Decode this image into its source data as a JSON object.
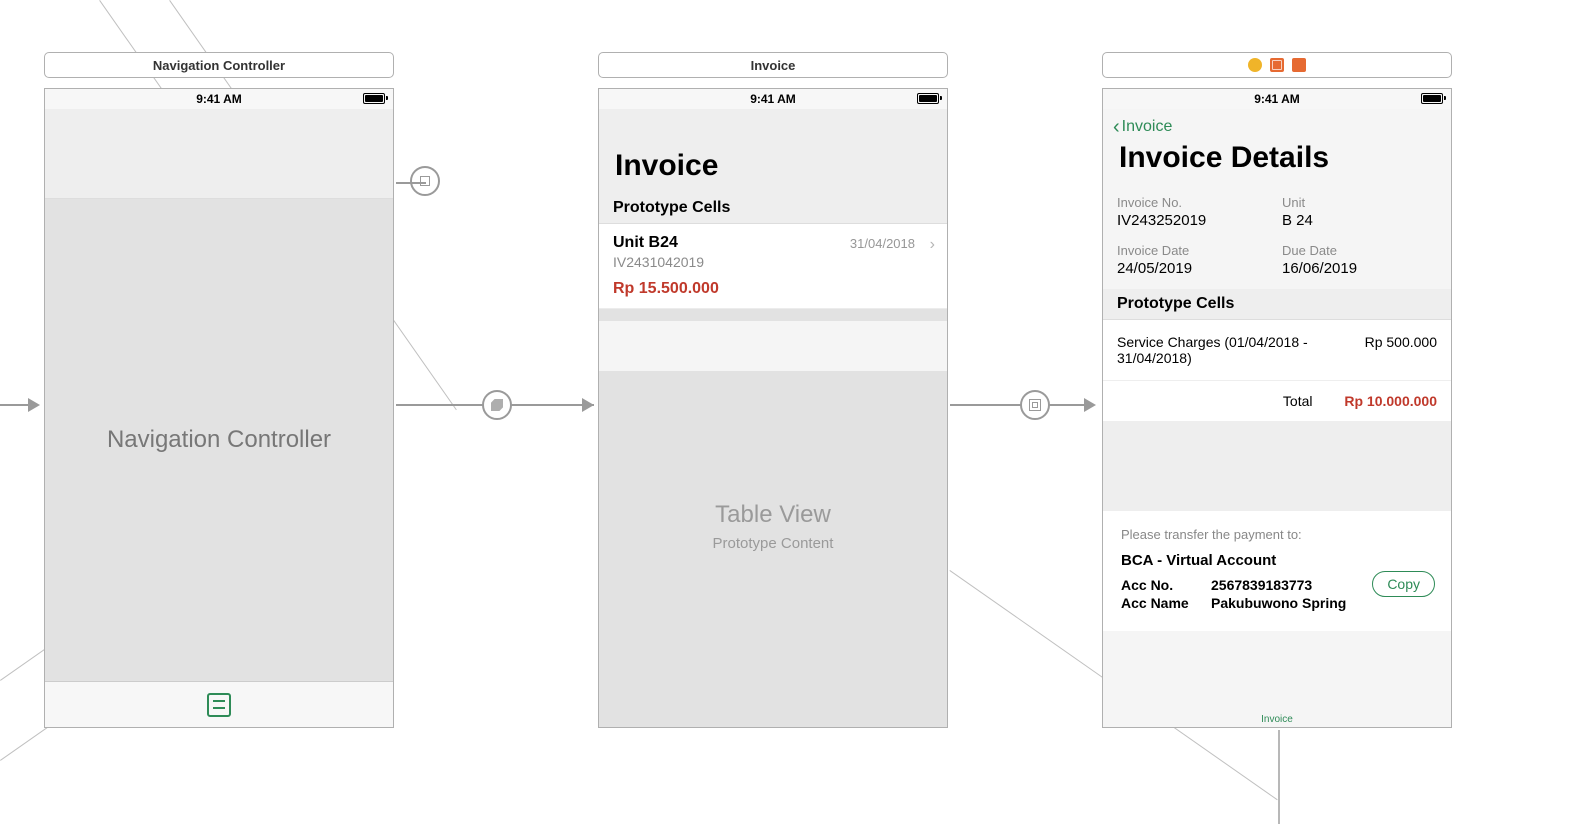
{
  "status_time": "9:41 AM",
  "scene1": {
    "title": "Navigation Controller",
    "body_label": "Navigation Controller"
  },
  "scene2": {
    "title": "Invoice",
    "large_title": "Invoice",
    "section": "Prototype Cells",
    "cell": {
      "unit": "Unit B24",
      "invoice_no": "IV2431042019",
      "price": "Rp 15.500.000",
      "date": "31/04/2018"
    },
    "placeholder_big": "Table View",
    "placeholder_small": "Prototype Content"
  },
  "scene3": {
    "back_label": "Invoice",
    "large_title": "Invoice Details",
    "meta": {
      "invoice_no_lbl": "Invoice No.",
      "invoice_no": "IV243252019",
      "unit_lbl": "Unit",
      "unit": "B 24",
      "invoice_date_lbl": "Invoice Date",
      "invoice_date": "24/05/2019",
      "due_date_lbl": "Due Date",
      "due_date": "16/06/2019"
    },
    "section": "Prototype Cells",
    "line_desc": "Service Charges (01/04/2018 - 31/04/2018)",
    "line_amount": "Rp 500.000",
    "total_lbl": "Total",
    "total_amount": "Rp 10.000.000",
    "payment": {
      "prompt": "Please transfer the payment to:",
      "bank": "BCA - Virtual Account",
      "accno_lbl": "Acc No.",
      "accno": "2567839183773",
      "accname_lbl": "Acc Name",
      "accname": "Pakubuwono Spring",
      "copy": "Copy"
    },
    "tab_label": "Invoice"
  }
}
